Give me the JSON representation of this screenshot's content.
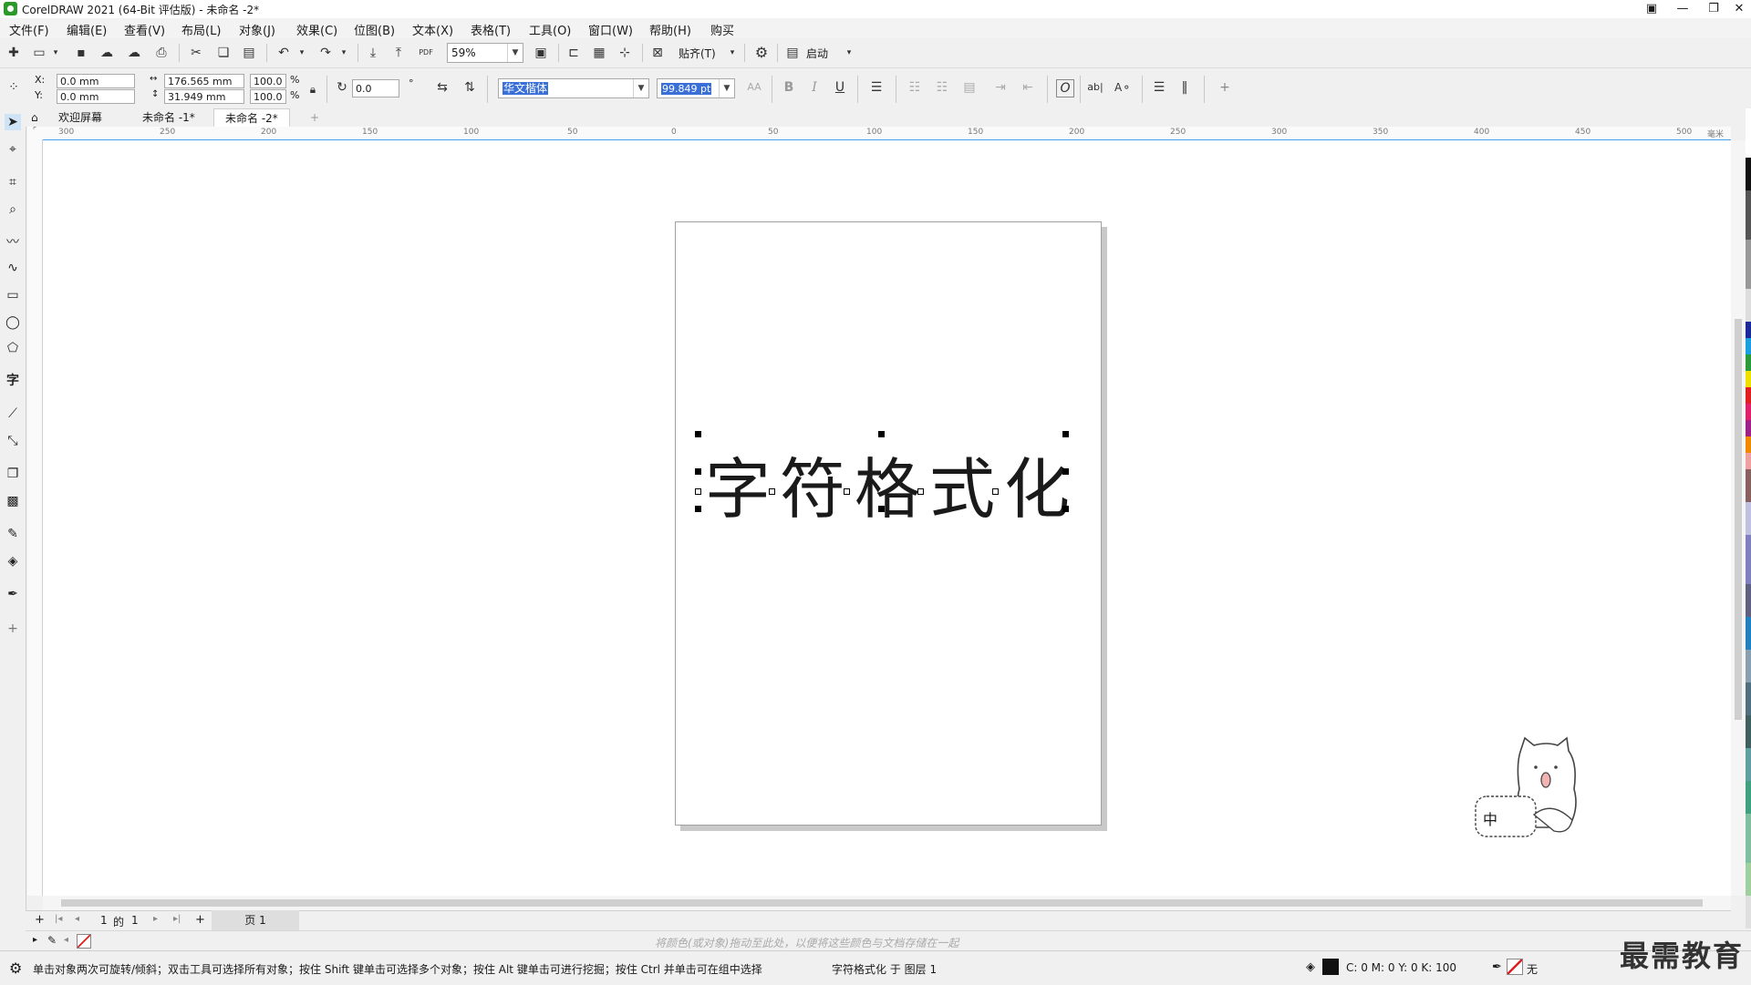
{
  "window": {
    "title": "CorelDRAW 2021 (64-Bit 评估版) - 未命名 -2*",
    "controls": [
      "▣",
      "—",
      "❐",
      "✕"
    ]
  },
  "menubar": {
    "items": [
      "文件(F)",
      "编辑(E)",
      "查看(V)",
      "布局(L)",
      "对象(J)",
      "效果(C)",
      "位图(B)",
      "文本(X)",
      "表格(T)",
      "工具(O)",
      "窗口(W)",
      "帮助(H)",
      "购买"
    ]
  },
  "toolbar": {
    "zoom": "59%",
    "snap_label": "贴齐(T)",
    "launch_label": "启动"
  },
  "propertybar": {
    "x_label": "X:",
    "x_value": "0.0 mm",
    "y_label": "Y:",
    "y_value": "0.0 mm",
    "width": "176.565 mm",
    "height": "31.949 mm",
    "scale_x": "100.0",
    "scale_y": "100.0",
    "percent": "%",
    "rotation": "0.0",
    "font_name": "华文楷体",
    "font_size": "99.849 pt"
  },
  "tabs": [
    "欢迎屏幕",
    "未命名 -1*",
    "未命名 -2*"
  ],
  "ruler": {
    "h_ticks": [
      "300",
      "250",
      "200",
      "150",
      "100",
      "50",
      "0",
      "50",
      "100",
      "150",
      "200",
      "250",
      "300",
      "350",
      "400",
      "450",
      "500"
    ],
    "unit": "毫米"
  },
  "canvas": {
    "text": "字符格式化"
  },
  "page_nav": {
    "current": "1",
    "of": "的",
    "total": "1",
    "page_tab": "页 1"
  },
  "color_hint": "将颜色(或对象)拖动至此处，以便将这些颜色与文档存储在一起",
  "status": {
    "hint": "单击对象两次可旋转/倾斜；双击工具可选择所有对象；按住 Shift 键单击可选择多个对象；按住 Alt 键单击可进行挖掘；按住 Ctrl 并单击可在组中选择",
    "object_info": "字符格式化 于 图层 1",
    "fill_values": "C: 0 M: 0 Y: 0 K: 100",
    "outline": "无"
  },
  "watermark": "最需教育",
  "mascot_text": "中",
  "colors": {
    "accent": "#3a6fd8",
    "ruler_line": "#4aa0e8",
    "logo": "#2b9a2b"
  }
}
